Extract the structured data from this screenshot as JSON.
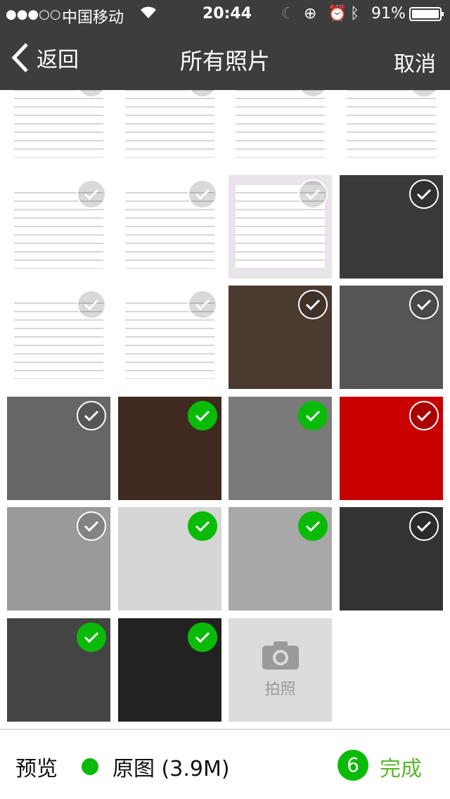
{
  "status_bar": {
    "signal": "●●●○○",
    "carrier": "中国移动",
    "time": "20:44",
    "battery": "91%"
  },
  "nav": {
    "back_label": "返回",
    "title": "所有照片",
    "cancel_label": "取消"
  },
  "colors": {
    "accent": "#09bb07",
    "done_text": "#5ab82f",
    "header_bg": "#3d3d3d"
  },
  "grid": {
    "tiles": [
      {
        "kind": "screenshot",
        "color": "#ffffff",
        "selected": false
      },
      {
        "kind": "screenshot",
        "color": "#ffffff",
        "selected": false
      },
      {
        "kind": "screenshot",
        "color": "#ffffff",
        "selected": false
      },
      {
        "kind": "screenshot",
        "color": "#ffffff",
        "selected": false
      },
      {
        "kind": "screenshot",
        "color": "#ffffff",
        "selected": false
      },
      {
        "kind": "screenshot",
        "color": "#ffffff",
        "selected": false
      },
      {
        "kind": "screenshot",
        "color": "#e8e4ea",
        "selected": false
      },
      {
        "kind": "photo",
        "color": "#3a3a3a",
        "selected": false
      },
      {
        "kind": "screenshot",
        "color": "#ffffff",
        "selected": false
      },
      {
        "kind": "screenshot",
        "color": "#ffffff",
        "selected": false
      },
      {
        "kind": "photo",
        "color": "#4a3a30",
        "selected": false
      },
      {
        "kind": "photo",
        "color": "#555555",
        "selected": false
      },
      {
        "kind": "photo",
        "color": "#666666",
        "selected": false
      },
      {
        "kind": "photo",
        "color": "#3e2a20",
        "selected": true
      },
      {
        "kind": "photo",
        "color": "#7a7a7a",
        "selected": true
      },
      {
        "kind": "photo",
        "color": "#c80000",
        "selected": false
      },
      {
        "kind": "photo",
        "color": "#9a9a9a",
        "selected": false
      },
      {
        "kind": "photo",
        "color": "#d6d6d6",
        "selected": true
      },
      {
        "kind": "photo",
        "color": "#a8a8a8",
        "selected": true
      },
      {
        "kind": "photo",
        "color": "#333333",
        "selected": false
      },
      {
        "kind": "photo",
        "color": "#444444",
        "selected": true
      },
      {
        "kind": "photo",
        "color": "#222222",
        "selected": true
      }
    ],
    "camera_label": "拍照"
  },
  "bottom": {
    "preview_label": "预览",
    "original_label": "原图 (3.9M)",
    "selected_count": "6",
    "done_label": "完成"
  }
}
